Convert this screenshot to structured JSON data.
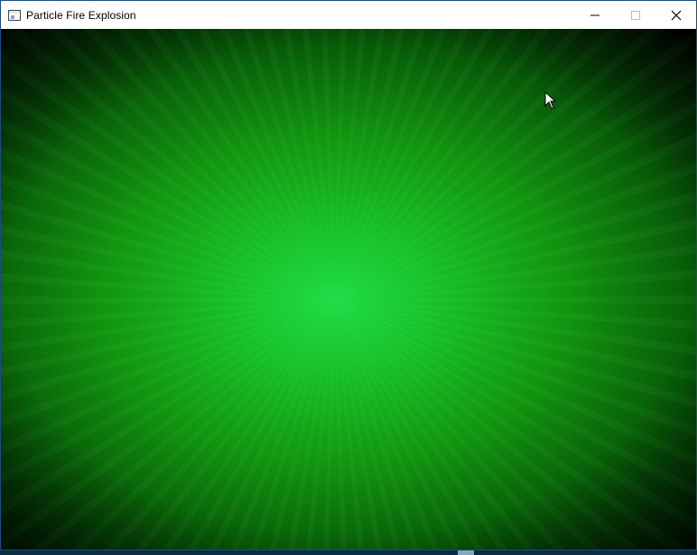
{
  "window": {
    "title": "Particle Fire Explosion",
    "icons": {
      "app": "window-app-icon",
      "minimize": "minimize-icon",
      "maximize": "maximize-icon",
      "close": "close-icon"
    }
  },
  "scene": {
    "description_type": "particle-simulation-canvas",
    "colors": {
      "core": "#1fdc46",
      "mid": "#14a512",
      "edge": "#025f08",
      "background": "#000000"
    }
  },
  "cursor": {
    "icon": "mouse-pointer-icon"
  }
}
